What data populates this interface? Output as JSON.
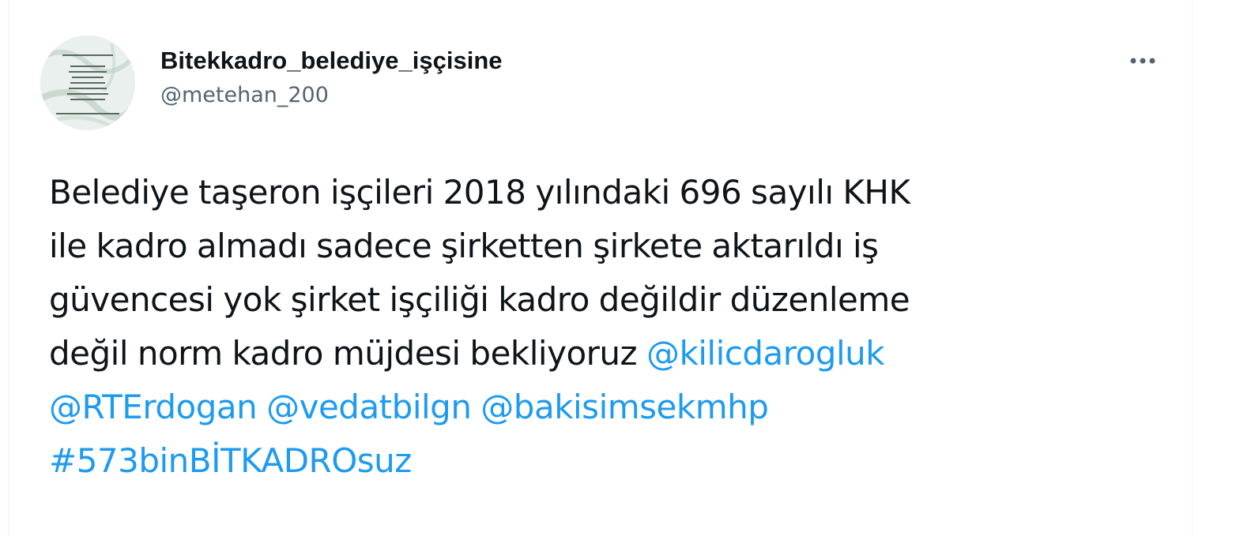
{
  "tweet": {
    "author": {
      "display_name": "Bitekkadro_belediye_işçisine",
      "handle": "@metehan_200",
      "avatar_icon": "avatar-image"
    },
    "more_icon": "more-options-icon",
    "text_lines": [
      "Belediye taşeron işçileri 2018 yılındaki 696 sayılı KHK",
      "ile kadro almadı sadece şirketten şirkete aktarıldı iş",
      "güvencesi yok şirket işçiliği kadro değildir düzenleme",
      "değil norm kadro müjdesi bekliyoruz "
    ],
    "mentions": [
      "@kilicdarogluk",
      "@RTErdogan",
      "@vedatbilgn",
      "@bakisimsekmhp"
    ],
    "hashtag": "#573binBİTKADROsuz"
  },
  "colors": {
    "text": "#0f1419",
    "secondary": "#536471",
    "link": "#1d9bf0",
    "border": "#eff3f4"
  }
}
